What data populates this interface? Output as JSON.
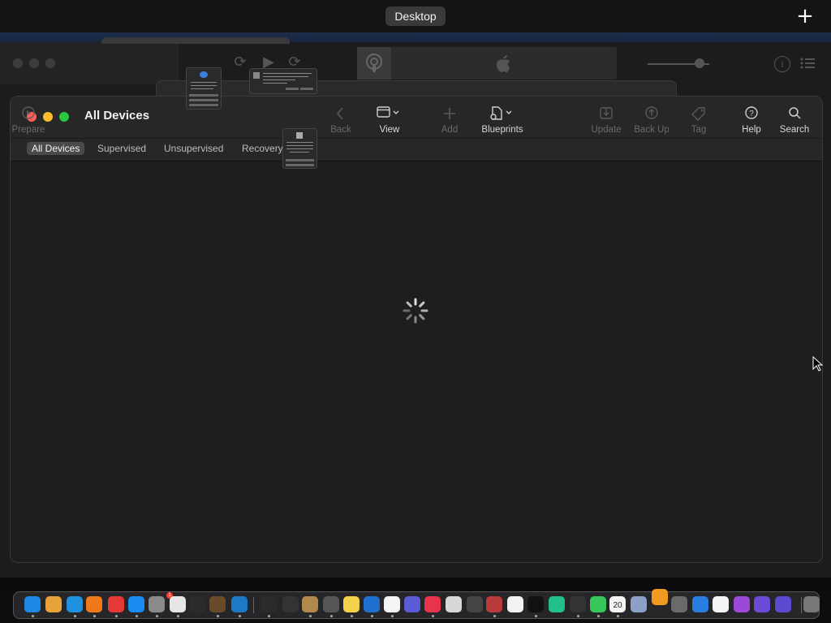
{
  "mission_control": {
    "space_label": "Desktop",
    "add_space_glyph": "+"
  },
  "window": {
    "title": "All Devices",
    "toolbar": [
      {
        "id": "back",
        "label": "Back",
        "icon": "chevron-left-icon",
        "enabled": false
      },
      {
        "id": "view",
        "label": "View",
        "icon": "window-view-icon",
        "enabled": true
      },
      {
        "id": "add",
        "label": "Add",
        "icon": "plus-icon",
        "enabled": false
      },
      {
        "id": "blueprints",
        "label": "Blueprints",
        "icon": "blueprint-icon",
        "enabled": true
      },
      {
        "id": "prepare",
        "label": "Prepare",
        "icon": "prepare-icon",
        "enabled": false
      },
      {
        "id": "update",
        "label": "Update",
        "icon": "update-icon",
        "enabled": false
      },
      {
        "id": "backup",
        "label": "Back Up",
        "icon": "backup-icon",
        "enabled": false
      },
      {
        "id": "tag",
        "label": "Tag",
        "icon": "tag-icon",
        "enabled": false
      },
      {
        "id": "help",
        "label": "Help",
        "icon": "help-icon",
        "enabled": true
      },
      {
        "id": "search",
        "label": "Search",
        "icon": "search-icon",
        "enabled": true
      }
    ],
    "tabs": [
      {
        "label": "All Devices",
        "active": true
      },
      {
        "label": "Supervised",
        "active": false
      },
      {
        "label": "Unsupervised",
        "active": false
      },
      {
        "label": "Recovery",
        "active": false
      }
    ],
    "state": "loading"
  },
  "dock": {
    "apps": [
      "finder-icon",
      "launchpad-icon",
      "safari-icon",
      "firefox-icon",
      "chrome-icon",
      "app-store-icon",
      "system-settings-icon",
      "script-editor-icon",
      "terminal-icon",
      "brush-icon",
      "vscode-icon",
      "console-icon",
      "voice-memos-icon",
      "archive-icon",
      "photo-booth-icon",
      "notes-icon",
      "cloud-icon",
      "reminders-icon",
      "configurator-icon",
      "news-icon",
      "font-book-icon",
      "chess-icon",
      "dictionary-icon",
      "stocks-icon",
      "tv-icon",
      "find-my-icon",
      "activity-monitor-icon",
      "messages-icon",
      "calendar-icon",
      "screen-sharing-icon",
      "books-icon",
      "calculator-icon",
      "keynote-icon",
      "clock-icon",
      "podcasts-icon",
      "visual-studio-icon",
      "utility-icon",
      "trash-icon"
    ],
    "calendar_day": "20",
    "badge_count": "1"
  }
}
